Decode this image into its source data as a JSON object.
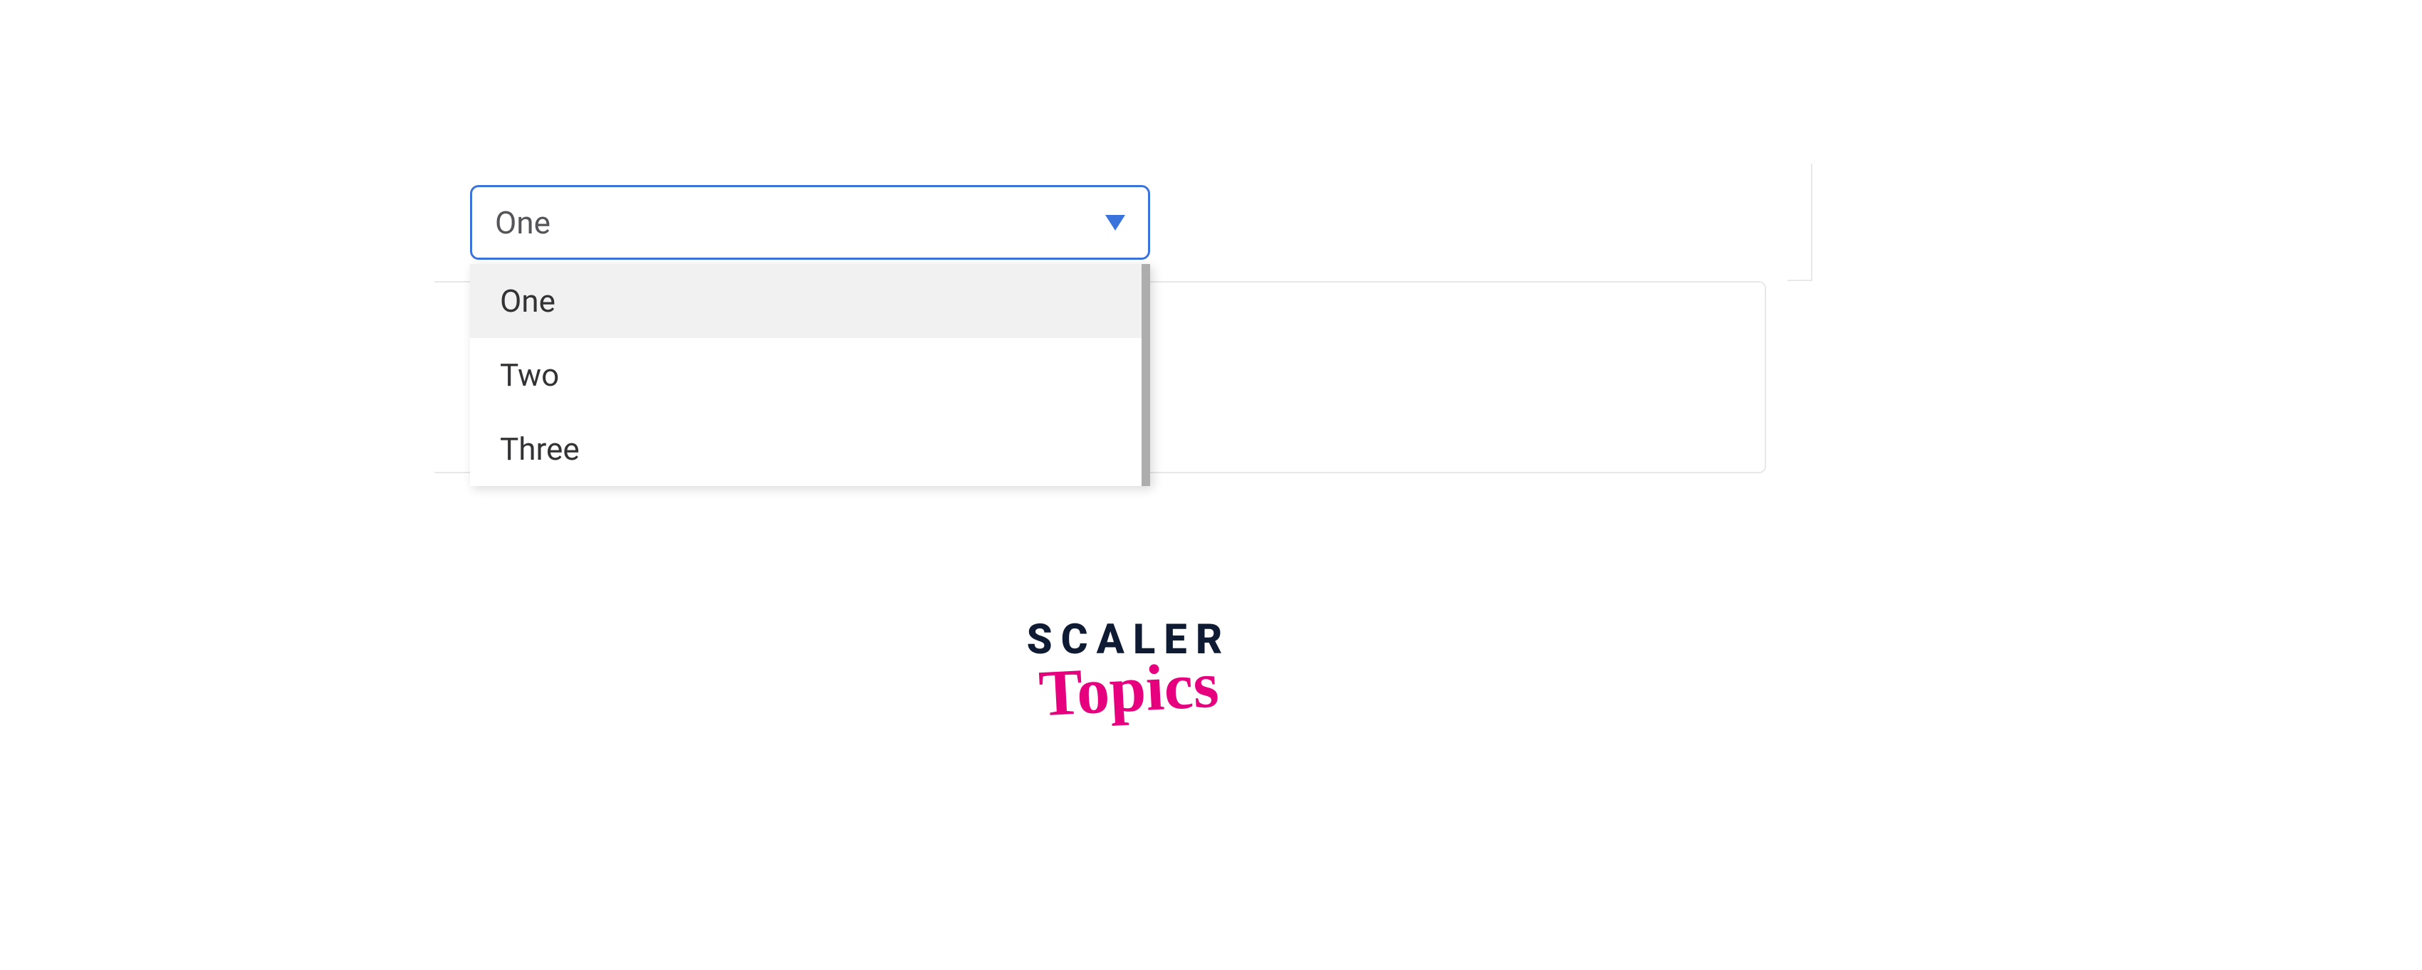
{
  "dropdown": {
    "selected": "One",
    "options": [
      {
        "label": "One",
        "highlighted": true
      },
      {
        "label": "Two",
        "highlighted": false
      },
      {
        "label": "Three",
        "highlighted": false
      }
    ]
  },
  "logo": {
    "primary": "SCALER",
    "script": "Topics"
  }
}
